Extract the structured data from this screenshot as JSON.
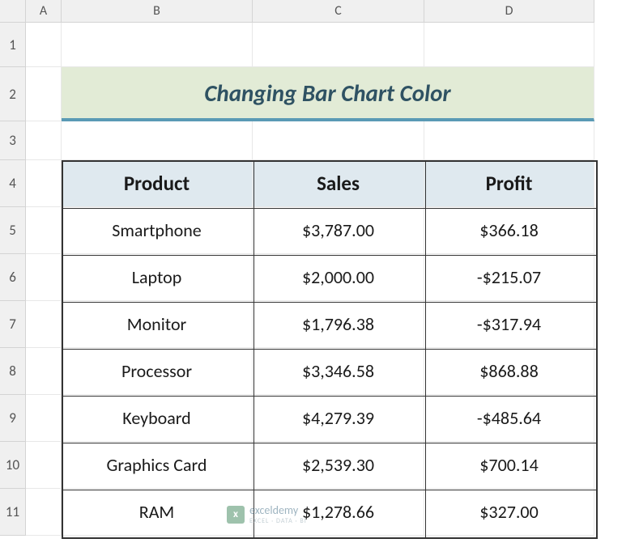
{
  "columns": [
    "A",
    "B",
    "C",
    "D"
  ],
  "rows": [
    "1",
    "2",
    "3",
    "4",
    "5",
    "6",
    "7",
    "8",
    "9",
    "10",
    "11"
  ],
  "title": "Changing Bar Chart Color",
  "table": {
    "headers": [
      "Product",
      "Sales",
      "Profit"
    ],
    "rows": [
      {
        "product": "Smartphone",
        "sales": "$3,787.00",
        "profit": "$366.18"
      },
      {
        "product": "Laptop",
        "sales": "$2,000.00",
        "profit": "-$215.07"
      },
      {
        "product": "Monitor",
        "sales": "$1,796.38",
        "profit": "-$317.94"
      },
      {
        "product": "Processor",
        "sales": "$3,346.58",
        "profit": "$868.88"
      },
      {
        "product": "Keyboard",
        "sales": "$4,279.39",
        "profit": "-$485.64"
      },
      {
        "product": "Graphics Card",
        "sales": "$2,539.30",
        "profit": "$700.14"
      },
      {
        "product": "RAM",
        "sales": "$1,278.66",
        "profit": "$327.00"
      }
    ]
  },
  "watermark": {
    "brand": "exceldemy",
    "tag": "EXCEL · DATA · BI"
  }
}
